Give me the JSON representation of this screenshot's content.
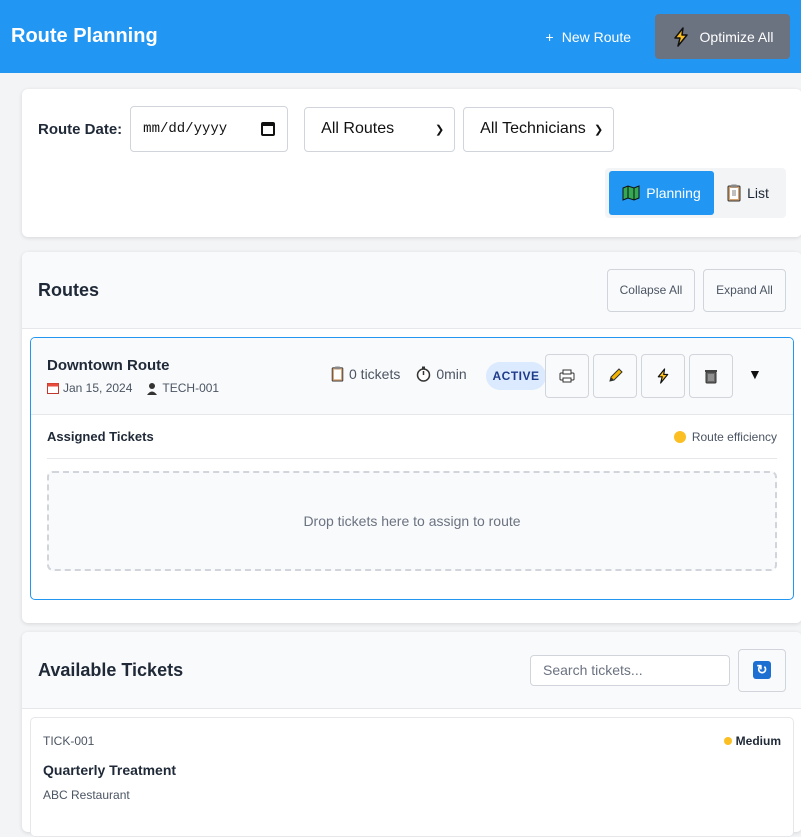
{
  "header": {
    "title": "Route Planning",
    "new_route_label": "New Route",
    "optimize_all_label": "Optimize All"
  },
  "filters": {
    "route_date_label": "Route Date:",
    "route_date_placeholder": "mm/dd/yyyy",
    "routes_select": "All Routes",
    "technicians_select": "All Technicians",
    "view_planning_label": "Planning",
    "view_list_label": "List"
  },
  "routes_section": {
    "title": "Routes",
    "collapse_all_label": "Collapse All",
    "expand_all_label": "Expand All",
    "route": {
      "name": "Downtown Route",
      "date": "Jan 15, 2024",
      "technician": "TECH-001",
      "tickets": "0 tickets",
      "duration": "0min",
      "status": "ACTIVE",
      "assigned_tickets_label": "Assigned Tickets",
      "efficiency_label": "Route efficiency",
      "dropzone_text": "Drop tickets here to assign to route"
    }
  },
  "available_section": {
    "title": "Available Tickets",
    "search_placeholder": "Search tickets...",
    "ticket": {
      "id": "TICK-001",
      "priority": "Medium",
      "title": "Quarterly Treatment",
      "customer": "ABC Restaurant"
    }
  },
  "colors": {
    "primary": "#2196f3",
    "optimize_button": "#6b7280",
    "priority_medium": "#fbbf24",
    "status_badge_bg": "#dbeafe"
  }
}
